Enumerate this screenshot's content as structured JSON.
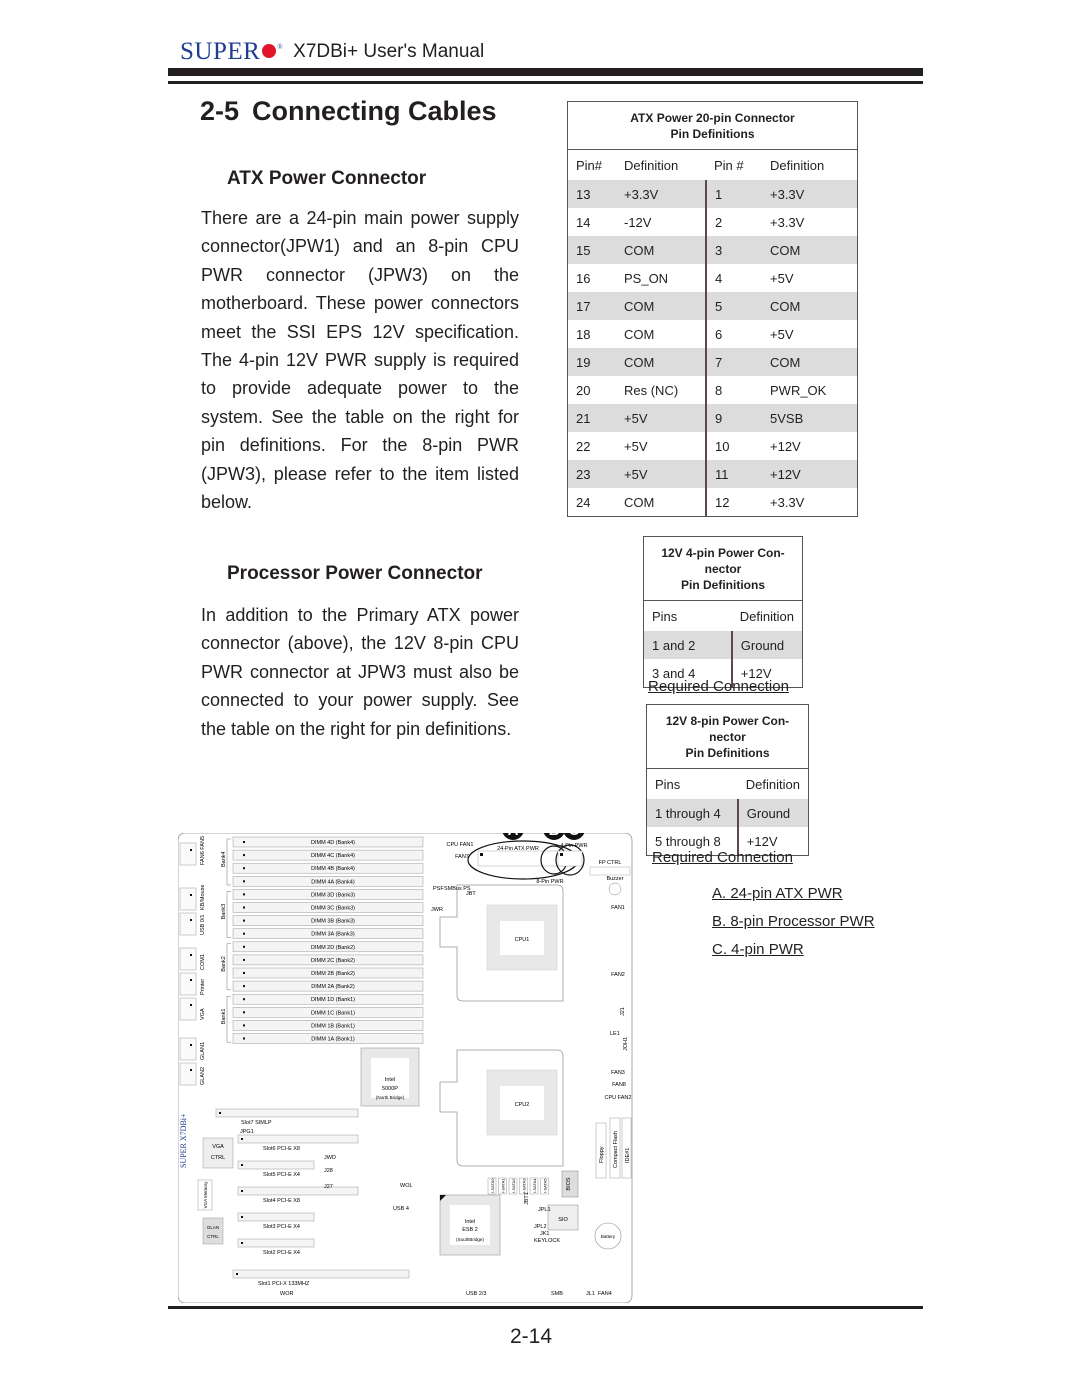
{
  "header": {
    "brand": "SUPER",
    "brand_mark": "®",
    "manual_title": "X7DBi+ User's Manual"
  },
  "section": {
    "number": "2-5",
    "title": "Connecting Cables"
  },
  "atx": {
    "heading": "ATX Power Connector",
    "body": "There are a 24-pin main power supply connector(JPW1) and an 8-pin CPU PWR connector (JPW3)  on the motherboard. These power connectors meet the SSI EPS 12V specification.  The 4-pin 12V PWR supply is required to provide adequate power to the system. See the table on the right for pin definitions. For the 8-pin PWR (JPW3), please refer to the item listed below."
  },
  "processor": {
    "heading": "Processor Power Connector",
    "body": "In addition to the Primary ATX power connector (above), the 12V 8-pin CPU PWR connector at JPW3 must also be connected to your power supply. See the table on the right for pin definitions."
  },
  "atx_table": {
    "caption_line1": "ATX Power 20-pin Connector",
    "caption_line2": "Pin Definitions",
    "headers": [
      "Pin#",
      "Definition",
      "Pin #",
      "Definition"
    ],
    "rows": [
      [
        "13",
        "+3.3V",
        "1",
        "+3.3V"
      ],
      [
        "14",
        "-12V",
        "2",
        "+3.3V"
      ],
      [
        "15",
        "COM",
        "3",
        "COM"
      ],
      [
        "16",
        "PS_ON",
        "4",
        "+5V"
      ],
      [
        "17",
        "COM",
        "5",
        "COM"
      ],
      [
        "18",
        "COM",
        "6",
        "+5V"
      ],
      [
        "19",
        "COM",
        "7",
        "COM"
      ],
      [
        "20",
        "Res (NC)",
        "8",
        "PWR_OK"
      ],
      [
        "21",
        "+5V",
        "9",
        "5VSB"
      ],
      [
        "22",
        "+5V",
        "10",
        "+12V"
      ],
      [
        "23",
        "+5V",
        "11",
        "+12V"
      ],
      [
        "24",
        "COM",
        "12",
        "+3.3V"
      ]
    ]
  },
  "pin4_table": {
    "caption_line1": "12V 4-pin  Power Con-",
    "caption_line2": "nector",
    "caption_line3": "Pin Definitions",
    "headers": [
      "Pins",
      "Definition"
    ],
    "rows": [
      [
        "1 and 2",
        "Ground"
      ],
      [
        "3 and 4",
        "+12V"
      ]
    ],
    "footer": "Required Connection"
  },
  "pin8_table": {
    "caption_line1": "12V 8-pin  Power Con-",
    "caption_line2": "nector",
    "caption_line3": "Pin Definitions",
    "headers": [
      "Pins",
      "Definition"
    ],
    "rows": [
      [
        "1 through 4",
        "Ground"
      ],
      [
        "5 through 8",
        "+12V"
      ]
    ],
    "footer": "Required Connection"
  },
  "legend": {
    "items": [
      "A. 24-pin ATX PWR",
      "B. 8-pin Processor PWR",
      "C. 4-pin PWR"
    ]
  },
  "board": {
    "markers": [
      "A",
      "B",
      "C"
    ],
    "dimms": [
      "DIMM 4D (Bank4)",
      "DIMM 4C (Bank4)",
      "DIMM 4B (Bank4)",
      "DIMM 4A (Bank4)",
      "DIMM 3D (Bank3)",
      "DIMM 3C (Bank3)",
      "DIMM 3B (Bank3)",
      "DIMM 3A (Bank3)",
      "DIMM 2D (Bank2)",
      "DIMM 2C (Bank2)",
      "DIMM 2B (Bank2)",
      "DIMM 2A (Bank2)",
      "DIMM 1D (Bank1)",
      "DIMM 1C (Bank1)",
      "DIMM 1B (Bank1)",
      "DIMM 1A (Bank1)"
    ],
    "banks": [
      "Bank4",
      "Bank3",
      "Bank2",
      "Bank1"
    ],
    "left_labels": [
      "FAN6 FAN5",
      "KB/Mouse",
      "USB 0/1",
      "COM1",
      "Printer",
      "VGA",
      "GLAN1",
      "GLAN2"
    ],
    "top_labels": {
      "cpu_fan": "CPU FAN1",
      "fan7": "FAN7",
      "atx24": "24-Pin ATX PWR",
      "pwr8": "8-Pin PWR",
      "pwr4": "4-Pin PWR",
      "fp_ctrl": "FP CTRL",
      "buzzer": "Buzzer",
      "psf": "PSF",
      "smbus": "SMBus PS",
      "jwr": "JWR",
      "jbt": "JBT",
      "fan1": "FAN1"
    },
    "cpus": [
      "CPU1",
      "CPU2"
    ],
    "right_labels": [
      "FAN2",
      "J21",
      "LE1",
      "JOH1",
      "FAN3",
      "FAN8",
      "CPU FAN2"
    ],
    "northbridge": [
      "Intel",
      "5000P",
      "(North Bridge)"
    ],
    "southbridge": [
      "Intel",
      "ESB 2",
      "(SouthBridge)"
    ],
    "slots": [
      "Slot7 SIMLP",
      "Slot6 PCI-E X8",
      "Slot5 PCI-E X4",
      "Slot4 PCI-E X8",
      "Slot3 PCI-E X4",
      "Slot2 PCI-E X4",
      "Slot1 PCI-X 133MHZ"
    ],
    "chips": {
      "vga_ctrl": [
        "VGA",
        "CTRL"
      ],
      "vga_mem": "VGA Memory",
      "glan_ctrl": [
        "GLAN",
        "CTRL"
      ],
      "sio": "SIO",
      "bios": "BIOS",
      "battery": "Battery"
    },
    "misc": {
      "jpg1": "JPG1",
      "jwd": "JWD",
      "j28": "J28",
      "j27": "J27",
      "wol": "WOL",
      "usb4": "USB 4",
      "usb23": "USB 2/3",
      "smb": "SMB",
      "jl1": "JL1",
      "fan4": "FAN4",
      "wor": "WOR",
      "jpl": "JPL1",
      "jpl2": "JPL2",
      "jk1": "JK1",
      "keylock": "KEYLOCK",
      "jbt1": "JBT1",
      "floppy": "Floppy",
      "cflash": "Compact Flash",
      "ide1": "IDE#1",
      "sata": [
        "I-SATA0",
        "I-SATA1",
        "I-SATA2",
        "I-SATA3",
        "I-SATA4",
        "I-SATA5"
      ],
      "brand_vertical": "SUPER X7DBi+"
    }
  },
  "footer": {
    "page_number": "2-14"
  }
}
